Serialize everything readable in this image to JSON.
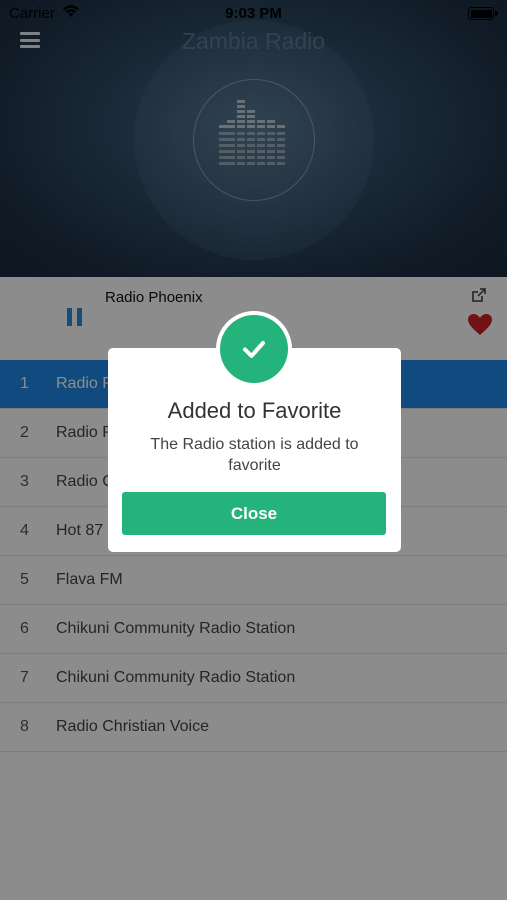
{
  "status_bar": {
    "carrier": "Carrier",
    "time": "9:03 PM"
  },
  "header": {
    "title": "Zambia Radio"
  },
  "player": {
    "now_playing": "Radio Phoenix"
  },
  "stations": [
    {
      "num": "1",
      "name": "Radio Phoenix"
    },
    {
      "num": "2",
      "name": "Radio Phoenix"
    },
    {
      "num": "3",
      "name": "Radio Christian Voice"
    },
    {
      "num": "4",
      "name": "Hot 87 FM"
    },
    {
      "num": "5",
      "name": "Flava FM"
    },
    {
      "num": "6",
      "name": "Chikuni Community Radio Station"
    },
    {
      "num": "7",
      "name": "Chikuni Community Radio Station"
    },
    {
      "num": "8",
      "name": "Radio Christian Voice"
    }
  ],
  "dialog": {
    "title": "Added to Favorite",
    "message": "The Radio station is added to favorite",
    "close_label": "Close"
  },
  "colors": {
    "accent": "#24b37a",
    "active_row": "#1e88e5",
    "heart": "#d0222a"
  }
}
